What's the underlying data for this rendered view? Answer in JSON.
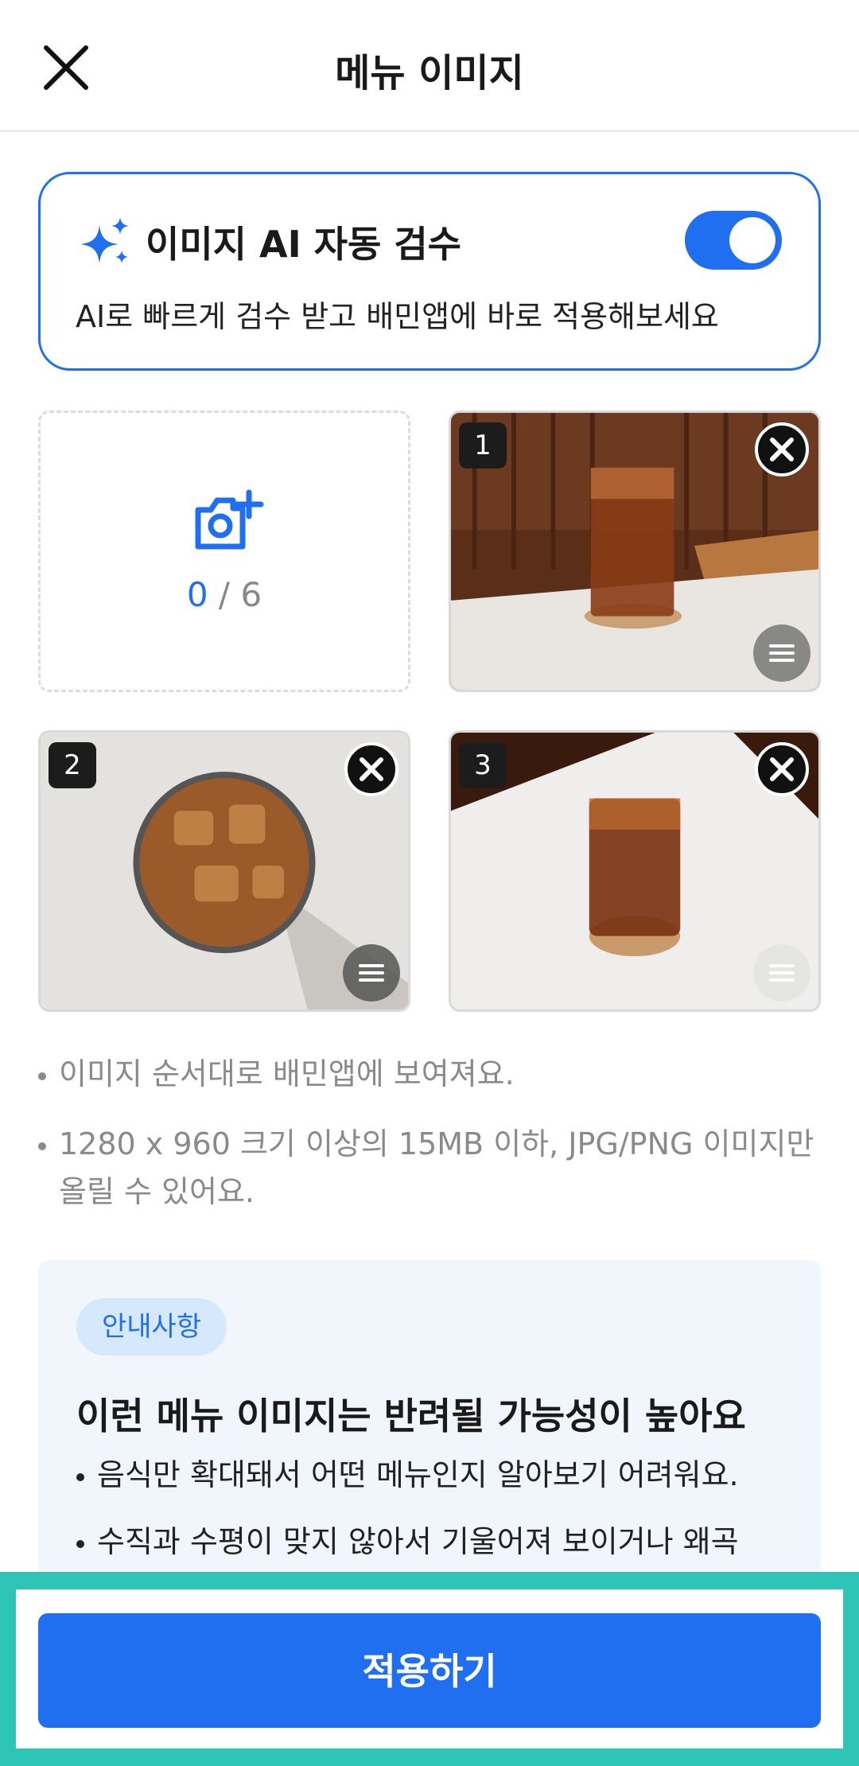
{
  "header": {
    "title": "메뉴 이미지",
    "close_icon": "close-icon"
  },
  "ai_review": {
    "title": "이미지 AI 자동 검수",
    "description": "AI로 빠르게 검수 받고 배민앱에 바로 적용해보세요",
    "enabled": true,
    "icon": "sparkle-icon"
  },
  "upload": {
    "icon": "camera-plus-icon",
    "current": "0",
    "separator": "/",
    "max": "6"
  },
  "images": [
    {
      "index": "1",
      "description": "iced coffee glass on coaster, side view"
    },
    {
      "index": "2",
      "description": "iced coffee glass, top view"
    },
    {
      "index": "3",
      "description": "iced coffee glass on coaster, table"
    }
  ],
  "notes": [
    "이미지 순서대로 배민앱에 보여져요.",
    "1280 x 960 크기 이상의 15MB 이하, JPG/PNG 이미지만 올릴 수 있어요."
  ],
  "info": {
    "tag": "안내사항",
    "title": "이런 메뉴 이미지는 반려될 가능성이 높아요",
    "items": [
      "음식만 확대돼서 어떤 메뉴인지 알아보기 어려워요.",
      "수직과 수평이 맞지 않아서 기울어져 보이거나 왜곡"
    ]
  },
  "apply_button": {
    "label": "적용하기"
  },
  "colors": {
    "accent": "#1f6ff0",
    "highlight": "#2ec4b6"
  }
}
